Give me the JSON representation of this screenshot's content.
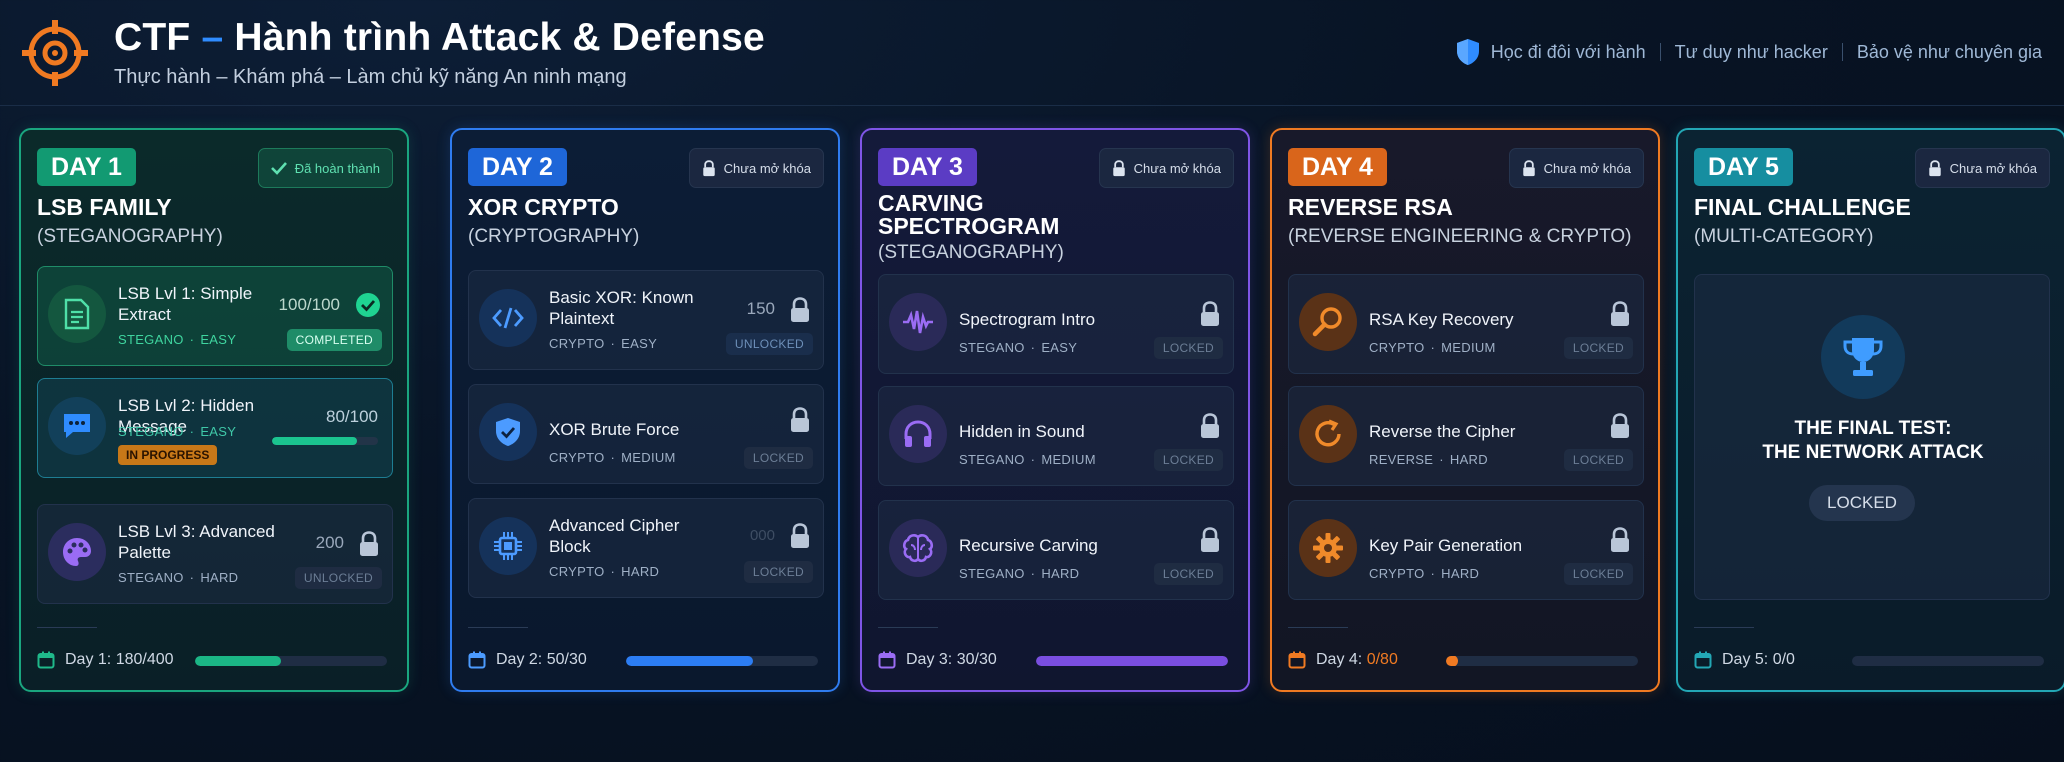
{
  "header": {
    "title_main": "CTF",
    "title_dash": " – ",
    "title_rest": "Hành trình Attack & Defense",
    "subtitle": "Thực hành – Khám phá – Làm chủ kỹ năng An ninh mạng",
    "taglines": [
      "Học đi đôi với hành",
      "Tư duy như hacker",
      "Bảo vệ như chuyên gia"
    ],
    "logo_icon": "target-icon",
    "shield_icon": "shield-icon"
  },
  "colors": {
    "day1": "#1aa67f",
    "day2": "#2f7cf0",
    "day3": "#7f55e6",
    "day4": "#f07a22",
    "day5": "#23a7b5"
  },
  "days": [
    {
      "badge": "DAY 1",
      "status": "Đã hoàn thành",
      "title": "LSB FAMILY",
      "category": "(STEGANOGRAPHY)",
      "challenges": [
        {
          "name": "LSB Lvl 1: Simple Extract",
          "category": "STEGANO",
          "difficulty": "EASY",
          "points": "100/100",
          "status": "COMPLETED",
          "icon": "document-icon"
        },
        {
          "name": "LSB Lvl 2: Hidden Message",
          "category": "STEGANO",
          "difficulty": "EASY",
          "points": "80/100",
          "status": "IN PROGRESS",
          "progress": 0.8,
          "icon": "chat-bubble-icon"
        },
        {
          "name": "LSB Lvl 3: Advanced Palette",
          "category": "STEGANO",
          "difficulty": "HARD",
          "points": "200",
          "status": "UNLOCKED",
          "icon": "palette-icon"
        }
      ],
      "footer_label": "Day 1:",
      "footer_value": "180/400",
      "footer_progress": 0.45
    },
    {
      "badge": "DAY 2",
      "status": "Chưa mở khóa",
      "title": "XOR CRYPTO",
      "category": "(CRYPTOGRAPHY)",
      "challenges": [
        {
          "name": "Basic XOR: Known Plaintext",
          "category": "CRYPTO",
          "difficulty": "EASY",
          "points": "150",
          "status": "UNLOCKED",
          "icon": "code-icon"
        },
        {
          "name": "XOR Brute Force",
          "category": "CRYPTO",
          "difficulty": "MEDIUM",
          "points": "",
          "status": "LOCKED",
          "icon": "shield-check-icon"
        },
        {
          "name": "Advanced Cipher Block",
          "category": "CRYPTO",
          "difficulty": "HARD",
          "points": "000",
          "status": "LOCKED",
          "icon": "chip-icon"
        }
      ],
      "footer_label": "Day 2:",
      "footer_value": "50/30",
      "footer_progress": 0.66
    },
    {
      "badge": "DAY 3",
      "status": "Chưa mở khóa",
      "title": "CARVING SPECTROGRAM",
      "category": "(STEGANOGRAPHY)",
      "challenges": [
        {
          "name": "Spectrogram Intro",
          "category": "STEGANO",
          "difficulty": "EASY",
          "points": "",
          "status": "LOCKED",
          "icon": "waveform-icon"
        },
        {
          "name": "Hidden in Sound",
          "category": "STEGANO",
          "difficulty": "MEDIUM",
          "points": "",
          "status": "LOCKED",
          "icon": "headphones-icon"
        },
        {
          "name": "Recursive Carving",
          "category": "STEGANO",
          "difficulty": "HARD",
          "points": "",
          "status": "LOCKED",
          "icon": "brain-icon"
        }
      ],
      "footer_label": "Day 3:",
      "footer_value": "30/30",
      "footer_progress": 1.0
    },
    {
      "badge": "DAY 4",
      "status": "Chưa mở khóa",
      "title": "REVERSE RSA",
      "category": "(REVERSE ENGINEERING & CRYPTO)",
      "challenges": [
        {
          "name": "RSA Key Recovery",
          "category": "CRYPTO",
          "difficulty": "MEDIUM",
          "points": "",
          "status": "LOCKED",
          "icon": "magnifier-icon"
        },
        {
          "name": "Reverse the Cipher",
          "category": "REVERSE",
          "difficulty": "HARD",
          "points": "",
          "status": "LOCKED",
          "icon": "rotate-icon"
        },
        {
          "name": "Key Pair Generation",
          "category": "CRYPTO",
          "difficulty": "HARD",
          "points": "",
          "status": "LOCKED",
          "icon": "gear-icon"
        }
      ],
      "footer_label": "Day 4:",
      "footer_value": "0/80",
      "footer_progress": 0.0
    },
    {
      "badge": "DAY 5",
      "status": "Chưa mở khóa",
      "title": "FINAL CHALLENGE",
      "category": "(MULTI-CATEGORY)",
      "final_line1": "THE FINAL TEST:",
      "final_line2": "THE NETWORK ATTACK",
      "final_status": "LOCKED",
      "footer_label": "Day 5:",
      "footer_value": "0/0",
      "footer_progress": 0.0
    }
  ]
}
